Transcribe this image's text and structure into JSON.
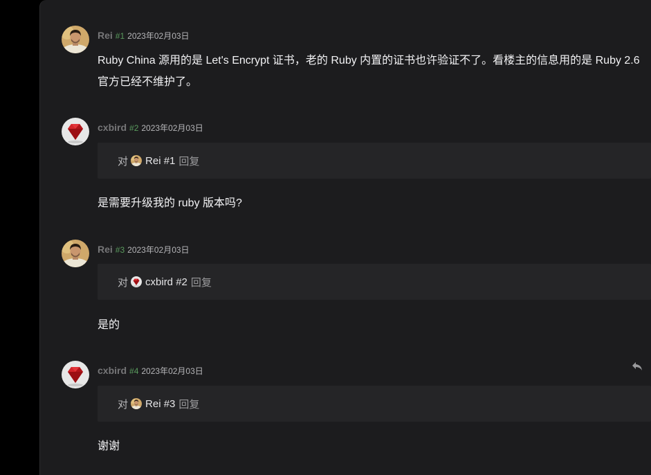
{
  "replies": [
    {
      "author": "Rei",
      "floor": "#1",
      "time": "2023年02月03日",
      "avatar": "man-photo-avatar",
      "body": "Ruby China 源用的是 Let's Encrypt 证书，老的 Ruby 内置的证书也许验证不了。看楼主的信息用的是 Ruby 2.6 官方已经不维护了。"
    },
    {
      "author": "cxbird",
      "floor": "#2",
      "time": "2023年02月03日",
      "avatar": "ruby-gem-avatar",
      "quote": {
        "prefix": "对",
        "target": "Rei #1",
        "target_avatar": "man-photo-avatar",
        "suffix": "回复"
      },
      "body": "是需要升级我的 ruby 版本吗?"
    },
    {
      "author": "Rei",
      "floor": "#3",
      "time": "2023年02月03日",
      "avatar": "man-photo-avatar",
      "quote": {
        "prefix": "对",
        "target": "cxbird #2",
        "target_avatar": "ruby-gem-avatar",
        "suffix": "回复"
      },
      "body": "是的"
    },
    {
      "author": "cxbird",
      "floor": "#4",
      "time": "2023年02月03日",
      "avatar": "ruby-gem-avatar",
      "quote": {
        "prefix": "对",
        "target": "Rei #3",
        "target_avatar": "man-photo-avatar",
        "suffix": "回复"
      },
      "body": "谢谢",
      "action_icon": "reply-arrow-icon"
    }
  ],
  "colors": {
    "background": "#1c1c1e",
    "quote_background": "#252527",
    "floor_green": "#5a9b5e",
    "ruby_red": "#c0161b"
  }
}
